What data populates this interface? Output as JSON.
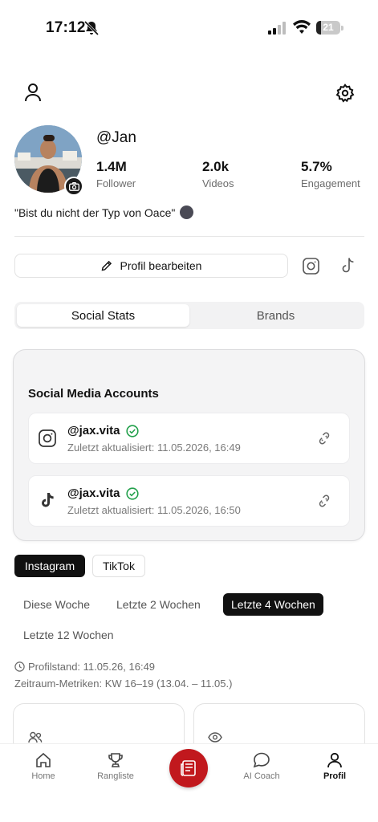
{
  "status_bar": {
    "time": "17:12",
    "battery_level": "21"
  },
  "profile": {
    "username": "@Jan",
    "stats": [
      {
        "value": "1.4M",
        "label": "Follower"
      },
      {
        "value": "2.0k",
        "label": "Videos"
      },
      {
        "value": "5.7%",
        "label": "Engagement"
      }
    ],
    "bio": "\"Bist du nicht der Typ von Oace\"",
    "edit_label": "Profil bearbeiten"
  },
  "segments": {
    "tabs": [
      "Social Stats",
      "Brands"
    ],
    "active": "Social Stats"
  },
  "accounts": {
    "title": "Social Media Accounts",
    "items": [
      {
        "platform": "instagram-icon",
        "handle": "@jax.vita",
        "updated": "Zuletzt aktualisiert: 11.05.2026, 16:49"
      },
      {
        "platform": "tiktok-icon",
        "handle": "@jax.vita",
        "updated": "Zuletzt aktualisiert: 11.05.2026, 16:50"
      }
    ]
  },
  "platform_chips": [
    "Instagram",
    "TikTok"
  ],
  "ranges": [
    "Diese Woche",
    "Letzte 2 Wochen",
    "Letzte 4 Wochen",
    "Letzte 12 Wochen"
  ],
  "meta": {
    "profile_state": "Profilstand: 11.05.26, 16:49",
    "period": "Zeitraum-Metriken: KW 16–19 (13.04. – 11.05.)"
  },
  "tabbar": {
    "items": [
      "Home",
      "Rangliste",
      "AI Coach",
      "Profil"
    ],
    "active": "Profil"
  },
  "colors": {
    "accent_red": "#c1181d",
    "verified_green": "#22a04b"
  }
}
